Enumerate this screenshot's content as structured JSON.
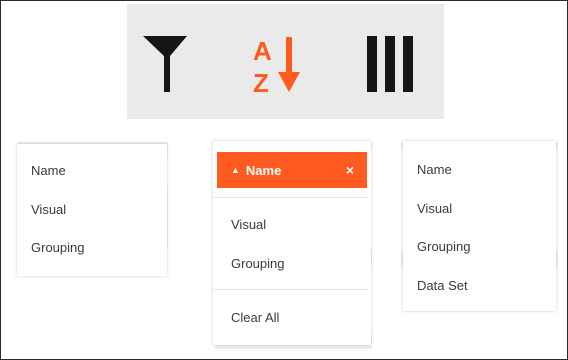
{
  "colors": {
    "accent": "#ff5a1f",
    "icon_dark": "#151515",
    "strip_bg": "#eaeaea"
  },
  "toolbar": {
    "icons": [
      "filter-icon",
      "sort-az-icon",
      "columns-icon"
    ],
    "sort_icon_letters": {
      "top": "A",
      "bottom": "Z"
    }
  },
  "left_menu": {
    "items": [
      {
        "label": "Name"
      },
      {
        "label": "Visual"
      },
      {
        "label": "Grouping"
      }
    ]
  },
  "sort_menu": {
    "header": {
      "label": "Name",
      "caret": "▲",
      "close": "×"
    },
    "items": [
      {
        "label": "Visual"
      },
      {
        "label": "Grouping"
      }
    ],
    "clear_label": "Clear All"
  },
  "right_menu": {
    "items": [
      {
        "label": "Name"
      },
      {
        "label": "Visual"
      },
      {
        "label": "Grouping"
      },
      {
        "label": "Data Set"
      }
    ]
  }
}
